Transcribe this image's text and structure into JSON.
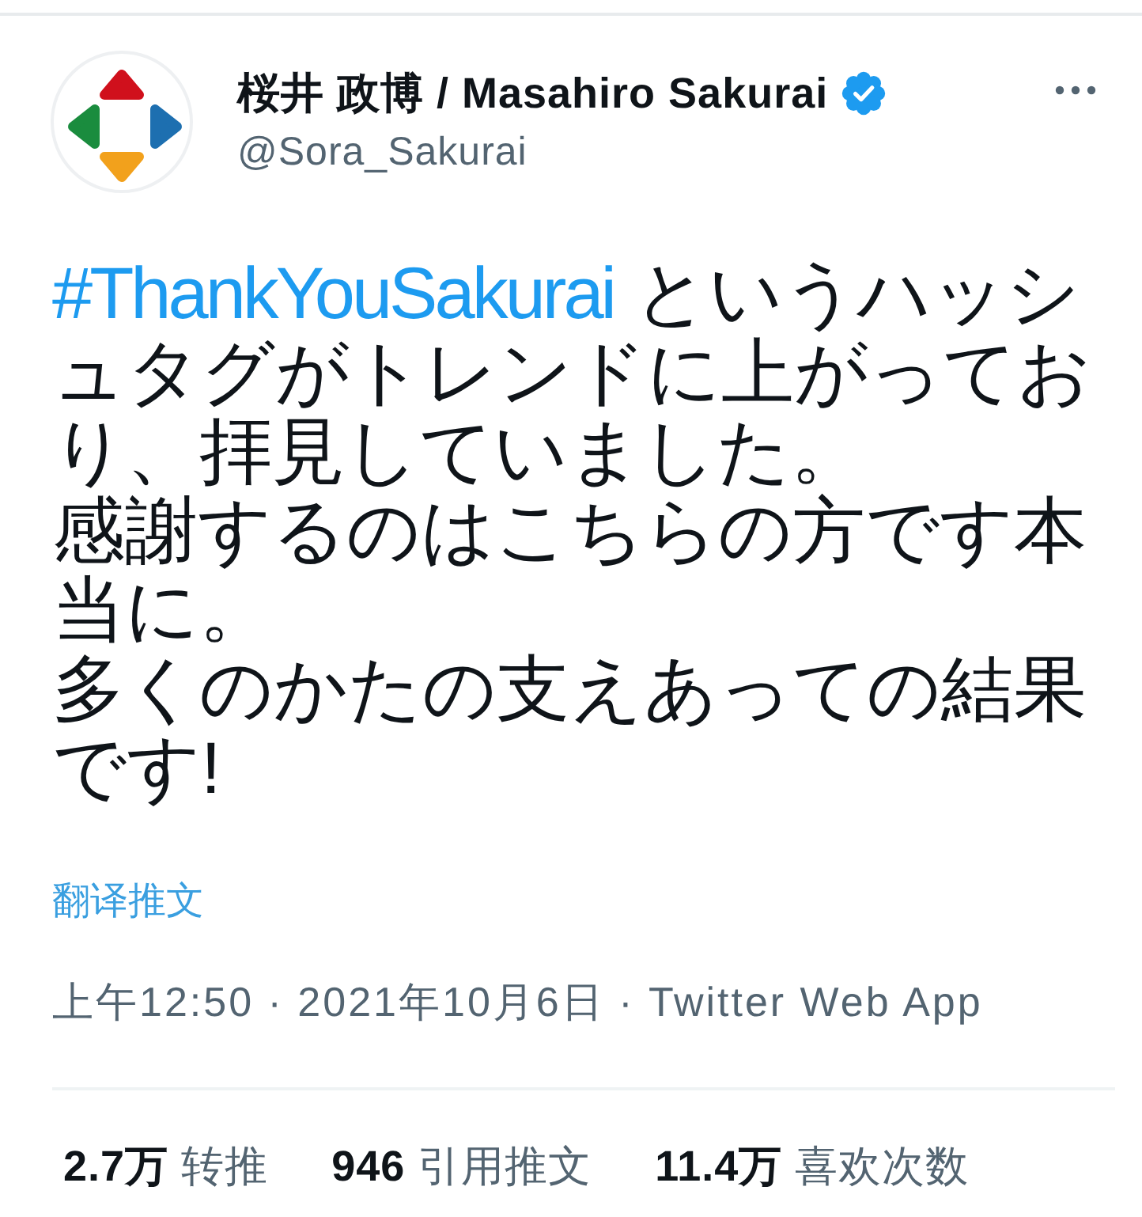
{
  "author": {
    "display_name": "桜井 政博 / Masahiro Sakurai",
    "verified": true,
    "handle": "@Sora_Sakurai"
  },
  "tweet": {
    "hashtag": "#ThankYouSakurai",
    "lines": [
      "というハッシ",
      "ュタグがトレンドに上がってお",
      "り、拝見していました。",
      "感謝するのはこちらの方です本",
      "当に。",
      "多くのかたの支えあっての結果",
      "です!"
    ]
  },
  "translate_link": "翻译推文",
  "timestamp": "上午12:50 · 2021年10月6日 · Twitter Web App",
  "stats": [
    {
      "count": "2.7万",
      "label": "转推"
    },
    {
      "count": "946",
      "label": "引用推文"
    },
    {
      "count": "11.4万",
      "label": "喜欢次数"
    }
  ]
}
